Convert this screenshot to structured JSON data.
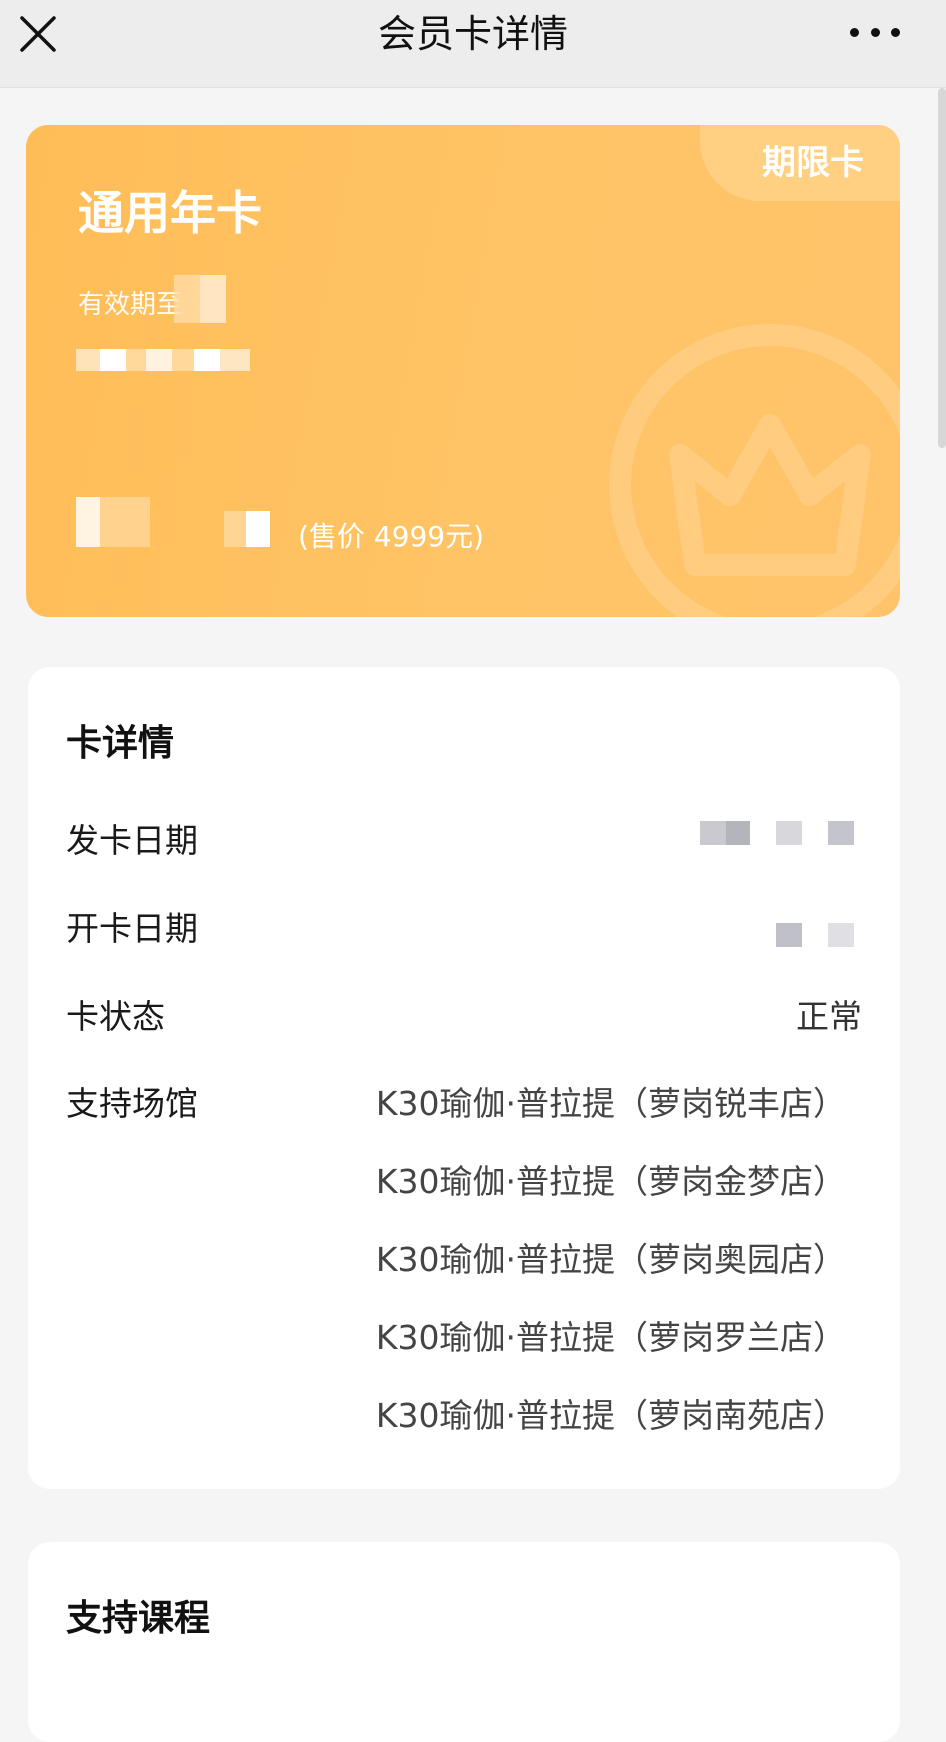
{
  "header": {
    "title": "会员卡详情",
    "close_icon": "close-icon",
    "more_icon": "more-icon"
  },
  "card": {
    "badge": "期限卡",
    "title": "通用年卡",
    "expire_label": "有效期至",
    "price_text": "(售价 4999元)",
    "colors": {
      "gradient_start": "#ffbd57",
      "gradient_end": "#ffc36a",
      "text": "#ffffff"
    },
    "decoration_icon": "crown-icon"
  },
  "card_details": {
    "title": "卡详情",
    "rows": [
      {
        "label": "发卡日期",
        "value": ""
      },
      {
        "label": "开卡日期",
        "value": ""
      },
      {
        "label": "卡状态",
        "value": "正常"
      },
      {
        "label": "支持场馆",
        "value": ""
      }
    ],
    "venues": [
      "K30瑜伽·普拉提（萝岗锐丰店）",
      "K30瑜伽·普拉提（萝岗金梦店）",
      "K30瑜伽·普拉提（萝岗奥园店）",
      "K30瑜伽·普拉提（萝岗罗兰店）",
      "K30瑜伽·普拉提（萝岗南苑店）"
    ]
  },
  "supported_courses": {
    "title": "支持课程"
  }
}
